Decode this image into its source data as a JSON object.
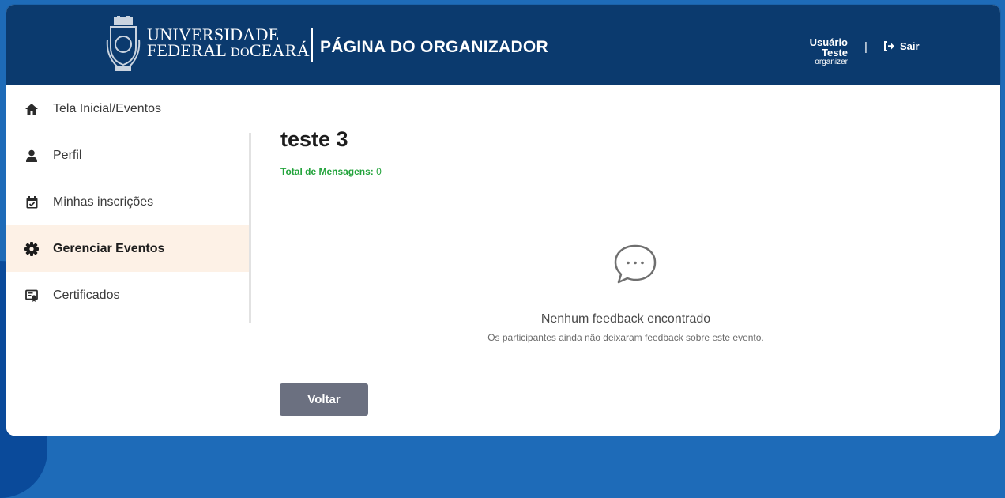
{
  "header": {
    "university_line1": "UNIVERSIDADE",
    "university_line2_a": "FEDERAL",
    "university_line2_b": "DO",
    "university_line2_c": "CEARÁ",
    "page_title": "PÁGINA DO ORGANIZADOR",
    "user_name": "Usuário Teste",
    "user_role": "organizer",
    "separator": "|",
    "logout_label": "Sair",
    "logout_icon": "sign-out-icon",
    "crest_icon": "university-crest-icon"
  },
  "sidebar": {
    "items": [
      {
        "label": "Tela Inicial/Eventos",
        "icon": "home-icon",
        "active": false
      },
      {
        "label": "Perfil",
        "icon": "user-icon",
        "active": false
      },
      {
        "label": "Minhas inscrições",
        "icon": "calendar-check-icon",
        "active": false
      },
      {
        "label": "Gerenciar Eventos",
        "icon": "gear-icon",
        "active": true
      },
      {
        "label": "Certificados",
        "icon": "certificate-icon",
        "active": false
      }
    ]
  },
  "main": {
    "event_title": "teste 3",
    "message_count_label": "Total de Mensagens:",
    "message_count_value": "0",
    "empty_state": {
      "icon": "chat-bubble-icon",
      "title": "Nenhum feedback encontrado",
      "subtitle": "Os participantes ainda não deixaram feedback sobre este evento."
    },
    "back_button_label": "Voltar"
  },
  "colors": {
    "header_bg": "#0b3a6e",
    "active_item_bg": "#fdf1e6",
    "count_green": "#22a33b",
    "button_gray": "#6b7080",
    "page_bg_blue": "#1e6bb8"
  }
}
